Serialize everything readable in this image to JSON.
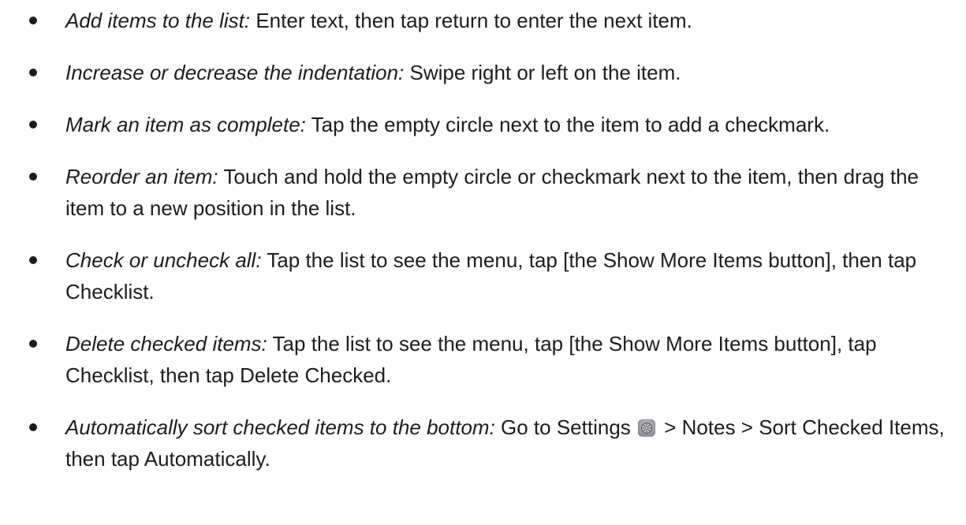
{
  "items": [
    {
      "term": "Add items to the list:",
      "text": " Enter text, then tap return to enter the next item."
    },
    {
      "term": "Increase or decrease the indentation:",
      "text": " Swipe right or left on the item."
    },
    {
      "term": "Mark an item as complete:",
      "text": " Tap the empty circle next to the item to add a checkmark."
    },
    {
      "term": "Reorder an item:",
      "text": " Touch and hold the empty circle or checkmark next to the item, then drag the item to a new position in the list."
    },
    {
      "term": "Check or uncheck all:",
      "text": " Tap the list to see the menu, tap [the Show More Items button], then tap Checklist."
    },
    {
      "term": "Delete checked items:",
      "text": " Tap the list to see the menu, tap [the Show More Items button], tap Checklist, then tap Delete Checked."
    },
    {
      "term": "Automatically sort checked items to the bottom:",
      "text_before": " Go to Settings",
      "icon": "settings-icon",
      "text_after": " > Notes > Sort Checked Items, then tap Automatically."
    }
  ]
}
